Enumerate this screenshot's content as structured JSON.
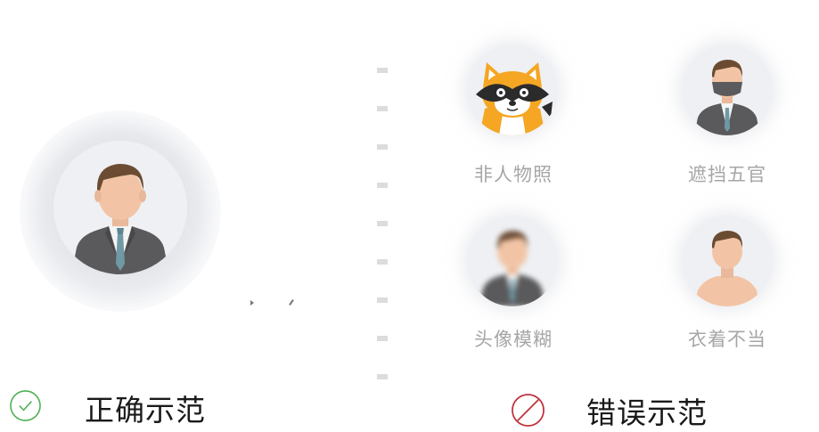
{
  "correct": {
    "title": "正确示范",
    "icon": "check-circle-icon",
    "accent": "#4caf50"
  },
  "wrong": {
    "title": "错误示范",
    "icon": "prohibited-icon",
    "accent": "#c0313a",
    "examples": [
      {
        "label": "非人物照",
        "icon": "raccoon-cartoon-icon"
      },
      {
        "label": "遮挡五官",
        "icon": "masked-person-icon"
      },
      {
        "label": "头像模糊",
        "icon": "blurred-person-icon"
      },
      {
        "label": "衣着不当",
        "icon": "shirtless-person-icon"
      }
    ]
  }
}
